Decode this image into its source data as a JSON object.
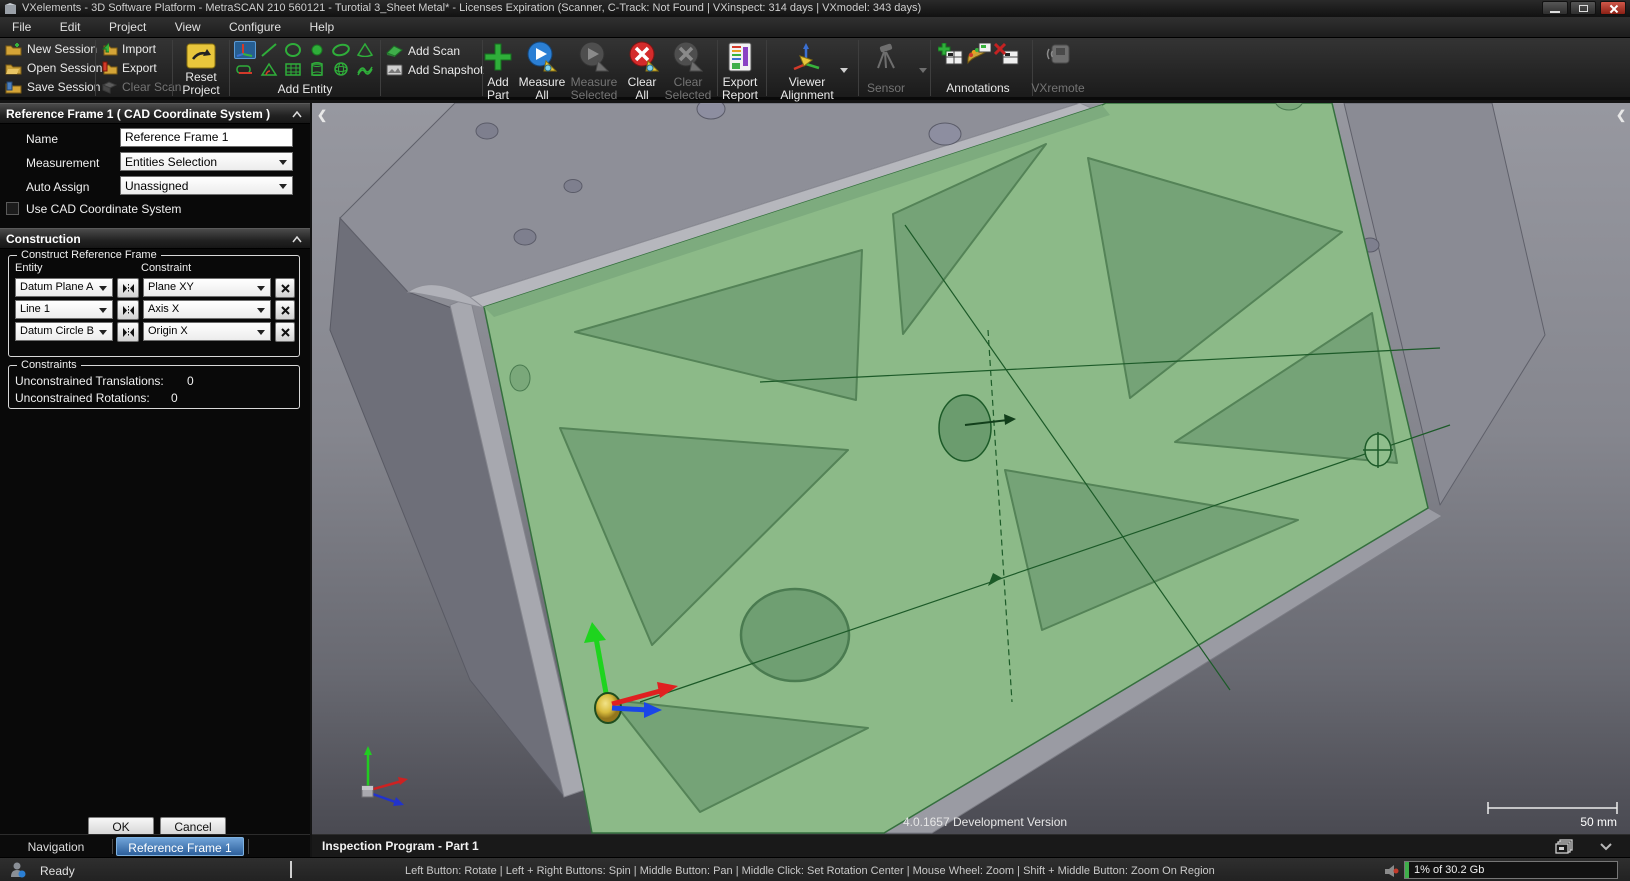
{
  "window": {
    "title": "VXelements - 3D Software Platform - MetraSCAN 210 560121 - Turotial 3_Sheet Metal* - Licenses Expiration (Scanner, C-Track: Not Found | VXinspect: 314 days | VXmodel: 343 days)"
  },
  "menu": {
    "items": [
      "File",
      "Edit",
      "Project",
      "View",
      "Configure",
      "Help"
    ]
  },
  "toolbar": {
    "session": [
      "New Session",
      "Open Session",
      "Save Session"
    ],
    "io": [
      "Import",
      "Export",
      "Clear Scan"
    ],
    "reset": [
      "Reset",
      "Project"
    ],
    "add_entity_label": "Add Entity",
    "scan": [
      "Add Scan",
      "Add Snapshot"
    ],
    "big": [
      {
        "l1": "Add",
        "l2": "Part"
      },
      {
        "l1": "Measure",
        "l2": "All"
      },
      {
        "l1": "Measure",
        "l2": "Selected"
      },
      {
        "l1": "Clear",
        "l2": "All"
      },
      {
        "l1": "Clear",
        "l2": "Selected"
      }
    ],
    "export_report": {
      "l1": "Export",
      "l2": "Report"
    },
    "viewer_alignment": {
      "l1": "Viewer",
      "l2": "Alignment"
    },
    "sensor_label": "Sensor",
    "annotations_label": "Annotations",
    "vxremote_label": "VXremote"
  },
  "panel": {
    "header": "Reference Frame 1 ( CAD Coordinate System )",
    "fields": [
      {
        "label": "Name",
        "value": "Reference Frame 1"
      },
      {
        "label": "Measurement",
        "value": "Entities Selection"
      },
      {
        "label": "Auto Assign",
        "value": "Unassigned"
      }
    ],
    "checkbox_label": "Use CAD Coordinate System",
    "construction": {
      "header": "Construction",
      "group_title": "Construct Reference Frame",
      "col_entity": "Entity",
      "col_constraint": "Constraint",
      "rows": [
        {
          "entity": "Datum Plane A",
          "constraint": "Plane XY"
        },
        {
          "entity": "Line 1",
          "constraint": "Axis X"
        },
        {
          "entity": "Datum Circle B",
          "constraint": "Origin X"
        }
      ]
    },
    "constraints": {
      "group_title": "Constraints",
      "items": [
        {
          "label": "Unconstrained Translations:",
          "value": "0"
        },
        {
          "label": "Unconstrained Rotations:",
          "value": "0"
        }
      ]
    },
    "ok_label": "OK",
    "cancel_label": "Cancel",
    "tabs": [
      "Navigation",
      "Reference Frame 1"
    ],
    "active_tab": "Reference Frame 1"
  },
  "viewport": {
    "version_text": "4.0.1657 Development Version",
    "scale_label": "50 mm",
    "program_title": "Inspection Program - Part 1"
  },
  "statusbar": {
    "ready": "Ready",
    "hints": "Left Button: Rotate  |  Left + Right Buttons: Spin  |  Middle Button: Pan  |  Middle Click: Set Rotation Center  |  Mouse Wheel: Zoom  |  Shift + Middle Button: Zoom On Region",
    "memory": "1% of 30.2 Gb"
  },
  "colors": {
    "selected_face_green": "#8cba88",
    "pocket_green": "#75a377",
    "construction_green": "#1c5a28",
    "active_tab_blue": "#2d5f9b",
    "tool_highlight_blue": "#265e92",
    "gauge_green": "#3fae4a"
  }
}
